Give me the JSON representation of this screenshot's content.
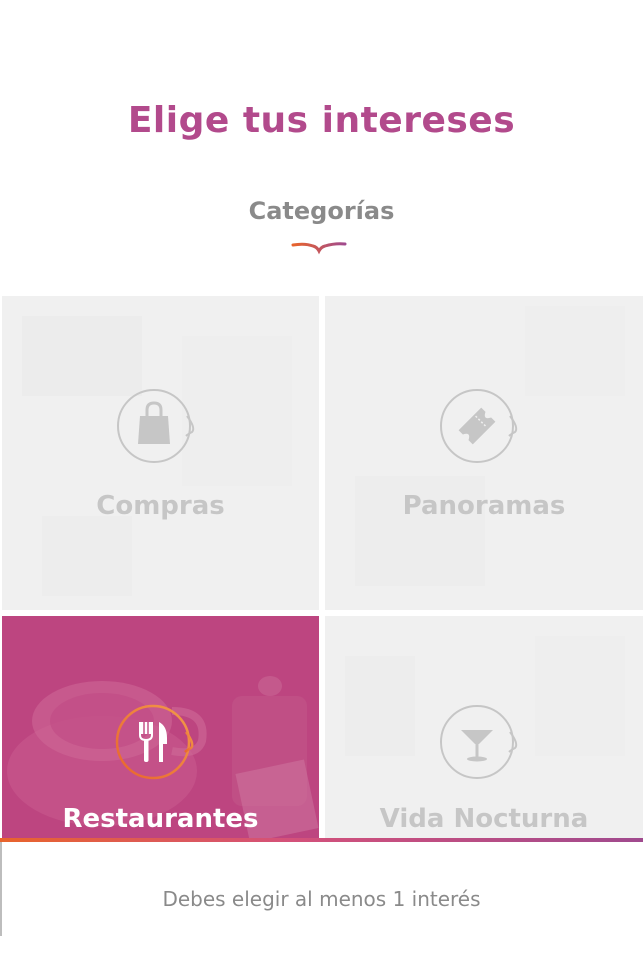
{
  "header": {
    "title": "Elige tus intereses",
    "subtitle": "Categorías"
  },
  "categories": [
    {
      "label": "Compras",
      "icon": "shopping-bag-icon",
      "selected": false
    },
    {
      "label": "Panoramas",
      "icon": "ticket-icon",
      "selected": false
    },
    {
      "label": "Restaurantes",
      "icon": "fork-knife-icon",
      "selected": true
    },
    {
      "label": "Vida Nocturna",
      "icon": "cocktail-glass-icon",
      "selected": false
    }
  ],
  "footer": {
    "message": "Debes elegir al menos 1 interés"
  },
  "colors": {
    "accent": "#b24a8c",
    "selected_tile": "#bf4680",
    "inactive_tile": "#f0f0f0",
    "inactive_text": "#c6c6c6",
    "gradient_start": "#e8642c",
    "gradient_end": "#a04a8e"
  }
}
